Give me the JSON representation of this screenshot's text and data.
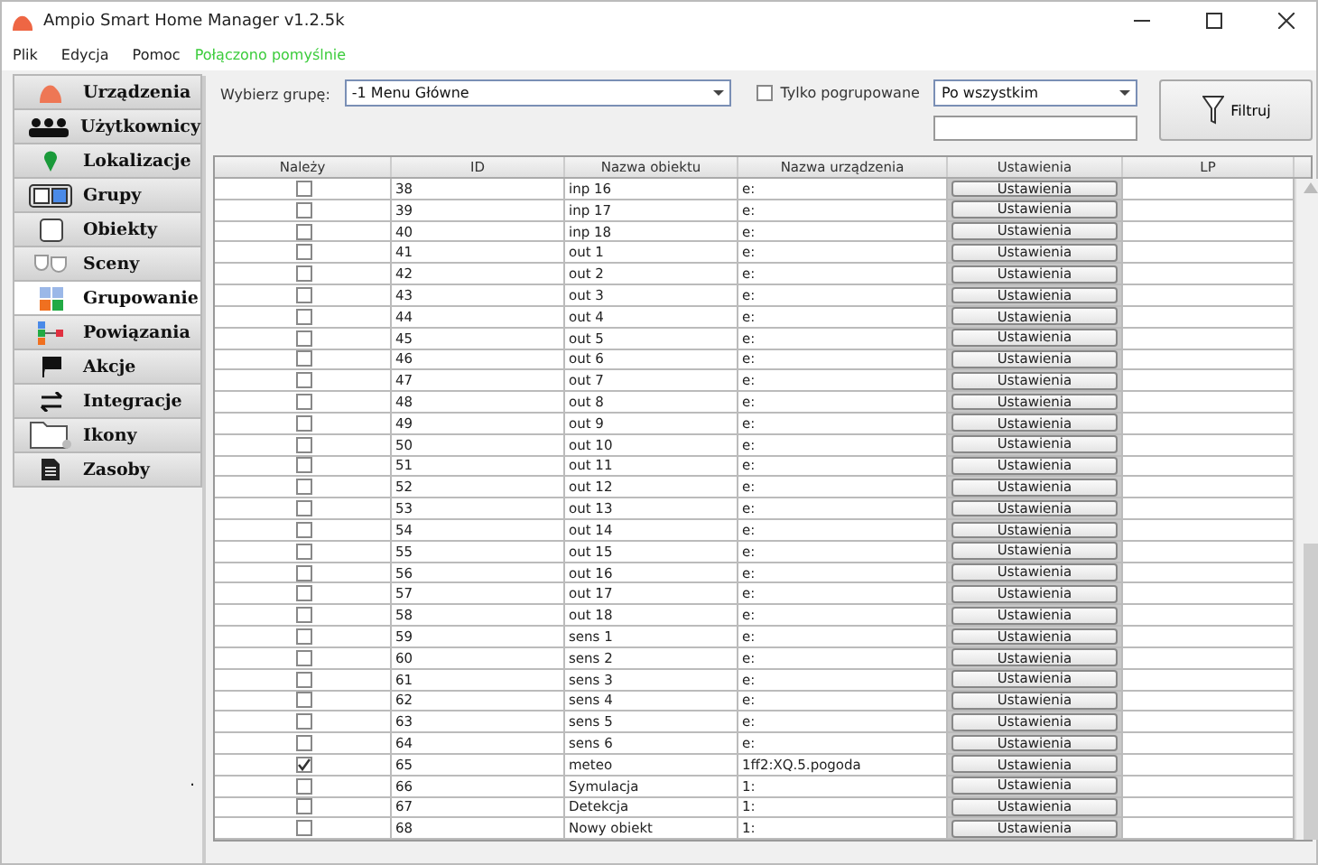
{
  "window": {
    "title": "Ampio Smart Home Manager v1.2.5k"
  },
  "menu": [
    "Plik",
    "Edycja",
    "Pomoc"
  ],
  "status": "Połączono pomyślnie",
  "sidebar": [
    {
      "label": "Urządzenia",
      "kind": "device",
      "selected": false
    },
    {
      "label": "Użytkownicy",
      "kind": "users",
      "selected": false
    },
    {
      "label": "Lokalizacje",
      "kind": "pin",
      "selected": false
    },
    {
      "label": "Grupy",
      "kind": "groups",
      "selected": false
    },
    {
      "label": "Obiekty",
      "kind": "object",
      "selected": false
    },
    {
      "label": "Sceny",
      "kind": "masks",
      "selected": false
    },
    {
      "label": "Grupowanie",
      "kind": "grid",
      "selected": true
    },
    {
      "label": "Powiązania",
      "kind": "link",
      "selected": false
    },
    {
      "label": "Akcje",
      "kind": "flag",
      "selected": false
    },
    {
      "label": "Integracje",
      "kind": "arrows",
      "selected": false
    },
    {
      "label": "Ikony",
      "kind": "folder",
      "selected": false
    },
    {
      "label": "Zasoby",
      "kind": "doc",
      "selected": false
    }
  ],
  "sidebar_footer": ".",
  "group_label": "Wybierz grupę:",
  "group_value": "-1 Menu Główne",
  "only_grouped": {
    "label": "Tylko pogrupowane",
    "checked": false
  },
  "sort_value": "Po wszystkim",
  "filter_button": "Filtruj",
  "table": {
    "columns": [
      "Należy",
      "ID",
      "Nazwa obiektu",
      "Nazwa urządzenia",
      "Ustawienia",
      "LP"
    ],
    "rows": [
      {
        "checked": false,
        "id": "38",
        "name": "inp 16",
        "device": "e:",
        "button": "Ustawienia"
      },
      {
        "checked": false,
        "id": "39",
        "name": "inp 17",
        "device": "e:",
        "button": "Ustawienia"
      },
      {
        "checked": false,
        "id": "40",
        "name": "inp 18",
        "device": "e:",
        "button": "Ustawienia"
      },
      {
        "checked": false,
        "id": "41",
        "name": "out 1",
        "device": "e:",
        "button": "Ustawienia"
      },
      {
        "checked": false,
        "id": "42",
        "name": "out 2",
        "device": "e:",
        "button": "Ustawienia"
      },
      {
        "checked": false,
        "id": "43",
        "name": "out 3",
        "device": "e:",
        "button": "Ustawienia"
      },
      {
        "checked": false,
        "id": "44",
        "name": "out 4",
        "device": "e:",
        "button": "Ustawienia"
      },
      {
        "checked": false,
        "id": "45",
        "name": "out 5",
        "device": "e:",
        "button": "Ustawienia"
      },
      {
        "checked": false,
        "id": "46",
        "name": "out 6",
        "device": "e:",
        "button": "Ustawienia"
      },
      {
        "checked": false,
        "id": "47",
        "name": "out 7",
        "device": "e:",
        "button": "Ustawienia"
      },
      {
        "checked": false,
        "id": "48",
        "name": "out 8",
        "device": "e:",
        "button": "Ustawienia"
      },
      {
        "checked": false,
        "id": "49",
        "name": "out 9",
        "device": "e:",
        "button": "Ustawienia"
      },
      {
        "checked": false,
        "id": "50",
        "name": "out 10",
        "device": "e:",
        "button": "Ustawienia"
      },
      {
        "checked": false,
        "id": "51",
        "name": "out 11",
        "device": "e:",
        "button": "Ustawienia"
      },
      {
        "checked": false,
        "id": "52",
        "name": "out 12",
        "device": "e:",
        "button": "Ustawienia"
      },
      {
        "checked": false,
        "id": "53",
        "name": "out 13",
        "device": "e:",
        "button": "Ustawienia"
      },
      {
        "checked": false,
        "id": "54",
        "name": "out 14",
        "device": "e:",
        "button": "Ustawienia"
      },
      {
        "checked": false,
        "id": "55",
        "name": "out 15",
        "device": "e:",
        "button": "Ustawienia"
      },
      {
        "checked": false,
        "id": "56",
        "name": "out 16",
        "device": "e:",
        "button": "Ustawienia"
      },
      {
        "checked": false,
        "id": "57",
        "name": "out 17",
        "device": "e:",
        "button": "Ustawienia"
      },
      {
        "checked": false,
        "id": "58",
        "name": "out 18",
        "device": "e:",
        "button": "Ustawienia"
      },
      {
        "checked": false,
        "id": "59",
        "name": "sens 1",
        "device": "e:",
        "button": "Ustawienia"
      },
      {
        "checked": false,
        "id": "60",
        "name": "sens 2",
        "device": "e:",
        "button": "Ustawienia"
      },
      {
        "checked": false,
        "id": "61",
        "name": "sens 3",
        "device": "e:",
        "button": "Ustawienia"
      },
      {
        "checked": false,
        "id": "62",
        "name": "sens 4",
        "device": "e:",
        "button": "Ustawienia"
      },
      {
        "checked": false,
        "id": "63",
        "name": "sens 5",
        "device": "e:",
        "button": "Ustawienia"
      },
      {
        "checked": false,
        "id": "64",
        "name": "sens 6",
        "device": "e:",
        "button": "Ustawienia"
      },
      {
        "checked": true,
        "id": "65",
        "name": "meteo",
        "device": "1ff2:XQ.5.pogoda",
        "button": "Ustawienia"
      },
      {
        "checked": false,
        "id": "66",
        "name": "Symulacja",
        "device": "1:",
        "button": "Ustawienia"
      },
      {
        "checked": false,
        "id": "67",
        "name": "Detekcja",
        "device": "1:",
        "button": "Ustawienia"
      },
      {
        "checked": false,
        "id": "68",
        "name": "Nowy obiekt",
        "device": "1:",
        "button": "Ustawienia"
      }
    ]
  }
}
